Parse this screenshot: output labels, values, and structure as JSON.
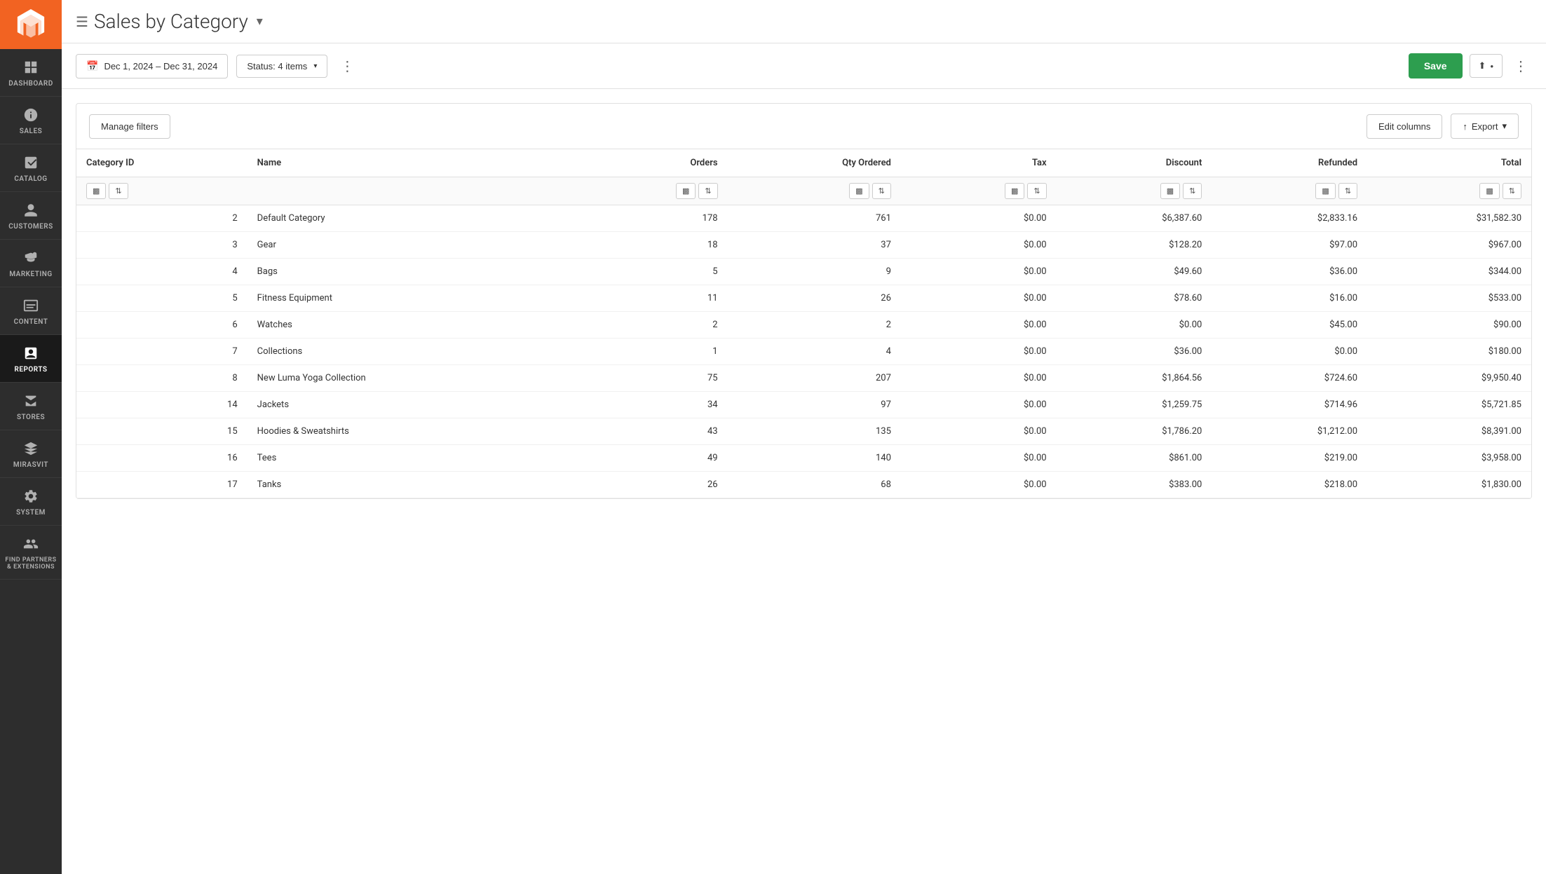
{
  "sidebar": {
    "logo_alt": "Magento Logo",
    "items": [
      {
        "id": "dashboard",
        "label": "DASHBOARD",
        "icon": "dashboard-icon"
      },
      {
        "id": "sales",
        "label": "SALES",
        "icon": "sales-icon"
      },
      {
        "id": "catalog",
        "label": "CATALOG",
        "icon": "catalog-icon"
      },
      {
        "id": "customers",
        "label": "CUSTOMERS",
        "icon": "customers-icon"
      },
      {
        "id": "marketing",
        "label": "MARKETING",
        "icon": "marketing-icon"
      },
      {
        "id": "content",
        "label": "CONTENT",
        "icon": "content-icon"
      },
      {
        "id": "reports",
        "label": "REPORTS",
        "icon": "reports-icon",
        "active": true
      },
      {
        "id": "stores",
        "label": "STORES",
        "icon": "stores-icon"
      },
      {
        "id": "mirasvit",
        "label": "MIRASVIT",
        "icon": "mirasvit-icon"
      },
      {
        "id": "system",
        "label": "SYSTEM",
        "icon": "system-icon"
      },
      {
        "id": "partners",
        "label": "FIND PARTNERS & EXTENSIONS",
        "icon": "partners-icon"
      }
    ]
  },
  "header": {
    "title": "Sales by Category",
    "menu_icon": "☰",
    "dropdown_icon": "▾"
  },
  "toolbar": {
    "date_range": "Dec 1, 2024 – Dec 31, 2024",
    "status_label": "Status: 4 items",
    "save_label": "Save",
    "share_label": "Share",
    "export_label": "Export"
  },
  "table": {
    "manage_filters_label": "Manage filters",
    "edit_columns_label": "Edit columns",
    "export_label": "↑ Export",
    "columns": [
      {
        "id": "category_id",
        "label": "Category ID"
      },
      {
        "id": "name",
        "label": "Name"
      },
      {
        "id": "orders",
        "label": "Orders"
      },
      {
        "id": "qty_ordered",
        "label": "Qty Ordered"
      },
      {
        "id": "tax",
        "label": "Tax"
      },
      {
        "id": "discount",
        "label": "Discount"
      },
      {
        "id": "refunded",
        "label": "Refunded"
      },
      {
        "id": "total",
        "label": "Total"
      }
    ],
    "rows": [
      {
        "category_id": "2",
        "name": "Default Category",
        "orders": "178",
        "qty_ordered": "761",
        "tax": "$0.00",
        "discount": "$6,387.60",
        "refunded": "$2,833.16",
        "total": "$31,582.30"
      },
      {
        "category_id": "3",
        "name": "Gear",
        "orders": "18",
        "qty_ordered": "37",
        "tax": "$0.00",
        "discount": "$128.20",
        "refunded": "$97.00",
        "total": "$967.00"
      },
      {
        "category_id": "4",
        "name": "Bags",
        "orders": "5",
        "qty_ordered": "9",
        "tax": "$0.00",
        "discount": "$49.60",
        "refunded": "$36.00",
        "total": "$344.00"
      },
      {
        "category_id": "5",
        "name": "Fitness Equipment",
        "orders": "11",
        "qty_ordered": "26",
        "tax": "$0.00",
        "discount": "$78.60",
        "refunded": "$16.00",
        "total": "$533.00"
      },
      {
        "category_id": "6",
        "name": "Watches",
        "orders": "2",
        "qty_ordered": "2",
        "tax": "$0.00",
        "discount": "$0.00",
        "refunded": "$45.00",
        "total": "$90.00"
      },
      {
        "category_id": "7",
        "name": "Collections",
        "orders": "1",
        "qty_ordered": "4",
        "tax": "$0.00",
        "discount": "$36.00",
        "refunded": "$0.00",
        "total": "$180.00"
      },
      {
        "category_id": "8",
        "name": "New Luma Yoga Collection",
        "orders": "75",
        "qty_ordered": "207",
        "tax": "$0.00",
        "discount": "$1,864.56",
        "refunded": "$724.60",
        "total": "$9,950.40"
      },
      {
        "category_id": "14",
        "name": "Jackets",
        "orders": "34",
        "qty_ordered": "97",
        "tax": "$0.00",
        "discount": "$1,259.75",
        "refunded": "$714.96",
        "total": "$5,721.85"
      },
      {
        "category_id": "15",
        "name": "Hoodies & Sweatshirts",
        "orders": "43",
        "qty_ordered": "135",
        "tax": "$0.00",
        "discount": "$1,786.20",
        "refunded": "$1,212.00",
        "total": "$8,391.00"
      },
      {
        "category_id": "16",
        "name": "Tees",
        "orders": "49",
        "qty_ordered": "140",
        "tax": "$0.00",
        "discount": "$861.00",
        "refunded": "$219.00",
        "total": "$3,958.00"
      },
      {
        "category_id": "17",
        "name": "Tanks",
        "orders": "26",
        "qty_ordered": "68",
        "tax": "$0.00",
        "discount": "$383.00",
        "refunded": "$218.00",
        "total": "$1,830.00"
      }
    ]
  }
}
